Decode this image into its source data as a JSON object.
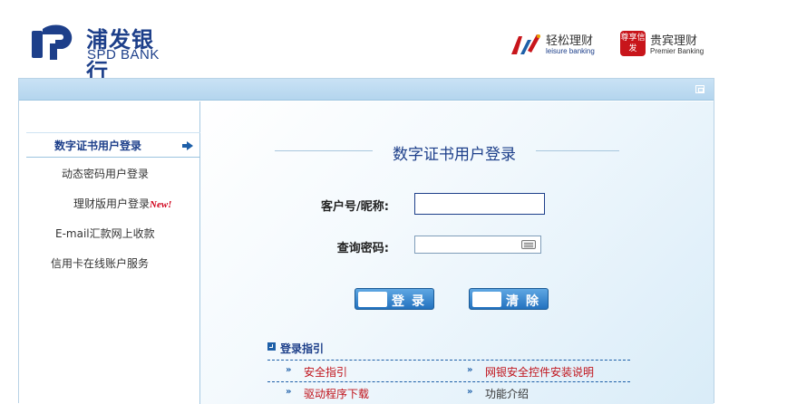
{
  "header": {
    "logo_cn": "浦发银行",
    "logo_en": "SPD BANK",
    "brand1_cn": "轻松理财",
    "brand1_en": "leisure banking",
    "brand2_seal": "尊享信发",
    "brand2_cn": "贵宾理财",
    "brand2_en": "Premier Banking"
  },
  "sidebar": {
    "items": [
      {
        "label": "数字证书用户登录"
      },
      {
        "label": "动态密码用户登录"
      },
      {
        "label": "理财版用户登录",
        "badge": "New!"
      },
      {
        "label": "E-mail汇款网上收款"
      },
      {
        "label": "信用卡在线账户服务"
      }
    ]
  },
  "main": {
    "title": "数字证书用户登录",
    "customer_label": "客户号/昵称:",
    "password_label": "查询密码:",
    "customer_value": "",
    "password_value": "",
    "login_button": "登录",
    "clear_button": "清除",
    "guide_title": "登录指引",
    "guide_links": [
      {
        "label": "安全指引",
        "color": "red"
      },
      {
        "label": "网银安全控件安装说明",
        "color": "red"
      },
      {
        "label": "驱动程序下载",
        "color": "red"
      },
      {
        "label": "功能介绍",
        "color": "black"
      }
    ]
  },
  "colors": {
    "brand_blue": "#1d3f8a",
    "link_red": "#c0131b",
    "panel_bar": "#c9e2f5"
  }
}
